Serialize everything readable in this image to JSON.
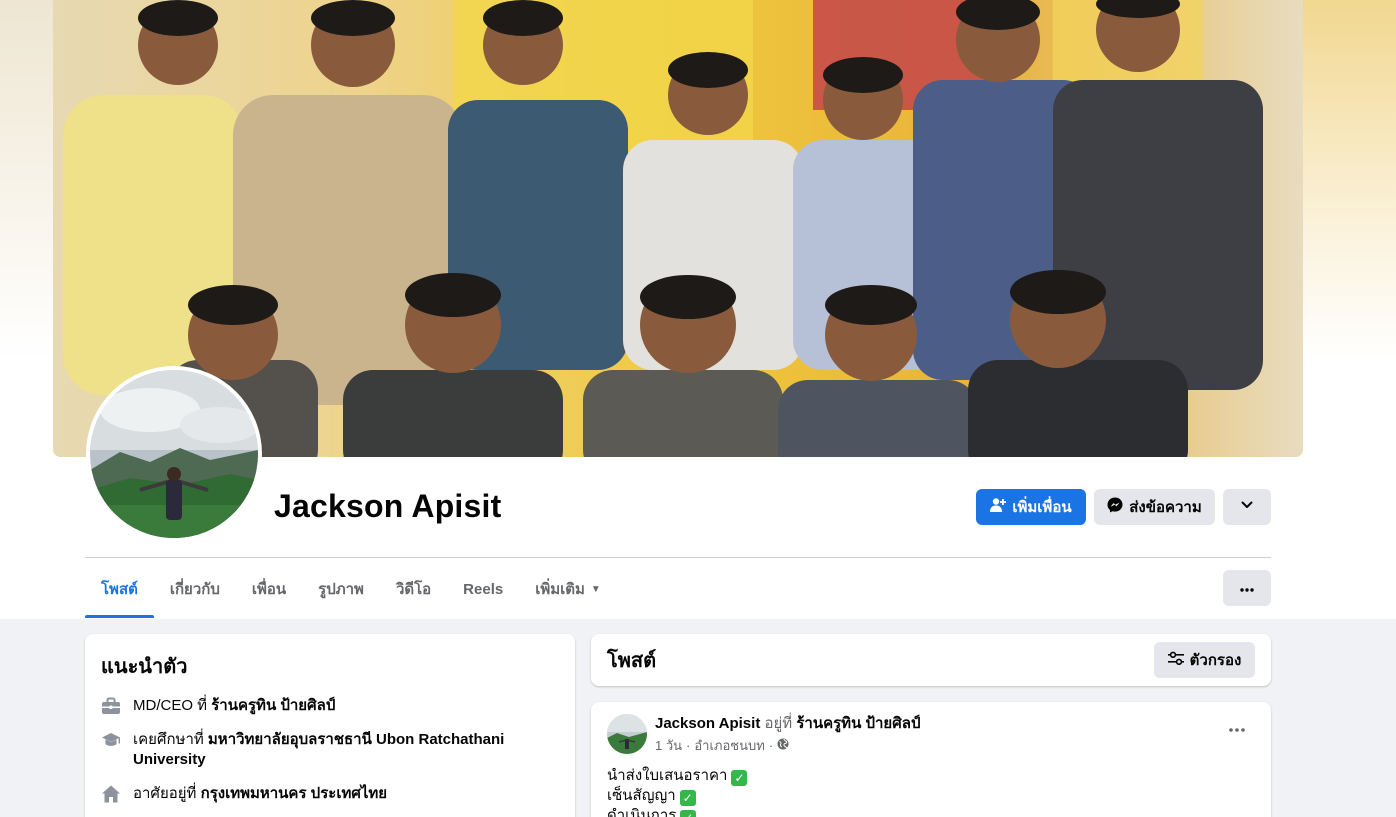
{
  "profile": {
    "name": "Jackson Apisit"
  },
  "actions": {
    "add_friend": "เพิ่มเพื่อน",
    "message": "ส่งข้อความ"
  },
  "tabs": [
    {
      "label": "โพสต์",
      "active": true
    },
    {
      "label": "เกี่ยวกับ"
    },
    {
      "label": "เพื่อน"
    },
    {
      "label": "รูปภาพ"
    },
    {
      "label": "วิดีโอ"
    },
    {
      "label": "Reels"
    },
    {
      "label": "เพิ่มเติม"
    }
  ],
  "intro": {
    "title": "แนะนำตัว",
    "work_prefix": "MD/CEO ที่ ",
    "work_place": "ร้านครูทิน ป้ายศิลป์",
    "study_prefix": "เคยศึกษาที่ ",
    "study_place": "มหาวิทยาลัยอุบลราชธานี Ubon Ratchathani University",
    "live_prefix": "อาศัยอยู่ที่ ",
    "live_place": "กรุงเทพมหานคร ประเทศไทย"
  },
  "posts": {
    "title": "โพสต์",
    "filter_label": "ตัวกรอง"
  },
  "post": {
    "author": "Jackson Apisit",
    "at_text": " อยู่ที่ ",
    "place": "ร้านครูทิน ป้ายศิลป์",
    "time": "1 วัน",
    "location": "อำเภอชนบท",
    "lines": [
      "นำส่งใบเสนอราคา",
      "เซ็นสัญญา",
      "ดำเนินการ"
    ]
  },
  "colors": {
    "accent": "#1b74e4",
    "button_gray": "#e4e6eb",
    "page_bg": "#f0f2f5",
    "check_green": "#35b74a"
  },
  "icons": {
    "add_friend": "person-plus-icon",
    "message": "messenger-icon",
    "more": "chevron-down-icon",
    "filter": "sliders-icon",
    "work": "briefcase-icon",
    "study": "graduation-cap-icon",
    "home": "home-icon",
    "globe": "globe-icon",
    "dots": "more-horizontal-icon"
  }
}
